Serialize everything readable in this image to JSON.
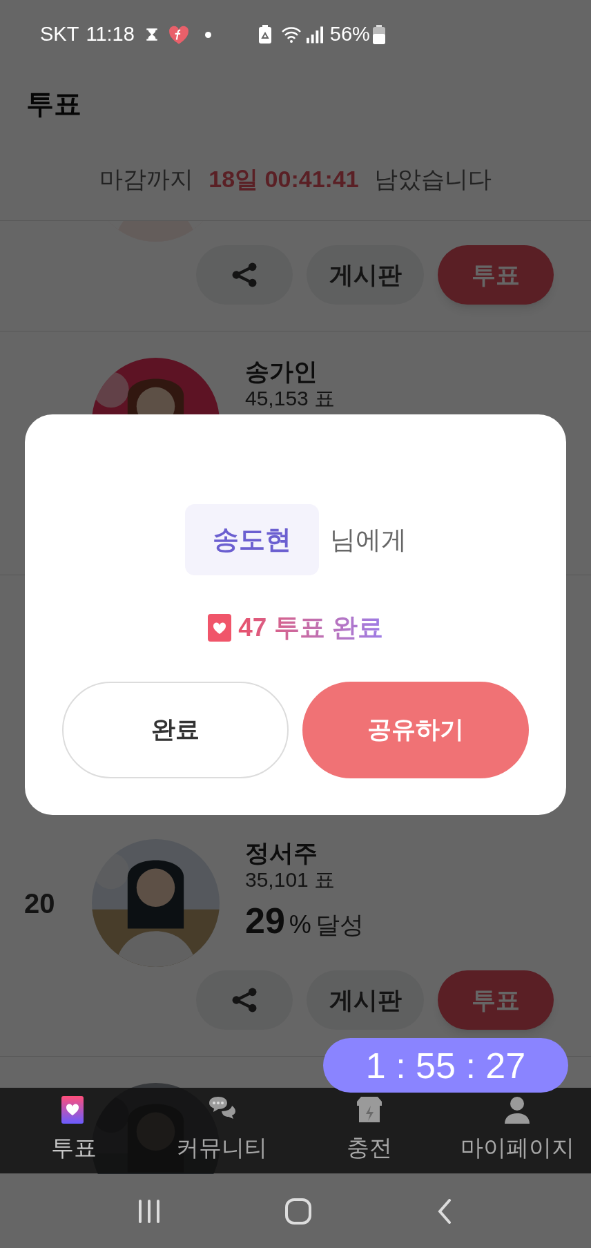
{
  "status_bar": {
    "carrier": "SKT",
    "time": "11:18",
    "battery": "56%"
  },
  "header": {
    "title": "투표"
  },
  "deadline": {
    "prefix": "마감까지",
    "remaining": "18일 00:41:41",
    "suffix": "남았습니다"
  },
  "candidates": [
    {
      "avatar": {
        "kind": "picture"
      },
      "board_button": "게시판",
      "vote_button": "투표"
    },
    {
      "avatar": {
        "kind": "picture"
      },
      "name": "송가인",
      "votes": "45,153 표"
    },
    {
      "avatar": {
        "kind": "picture"
      },
      "rank": "20",
      "name": "정서주",
      "votes": "35,101 표",
      "percent": "29",
      "percent_unit": "%",
      "percent_label": "달성",
      "board_button": "게시판",
      "vote_button": "투표"
    },
    {
      "avatar": {
        "kind": "picture"
      }
    }
  ],
  "bottom_nav": [
    {
      "label": "투표",
      "selected": true
    },
    {
      "label": "커뮤니티",
      "selected": false
    },
    {
      "label": "충전",
      "selected": false
    },
    {
      "label": "마이페이지",
      "selected": false
    }
  ],
  "dialog": {
    "recipient": "송도현",
    "recipient_suffix": "님에게",
    "result": "47 투표 완료",
    "buttons": [
      {
        "label": "완료",
        "kind": "secondary"
      },
      {
        "label": "공유하기",
        "kind": "primary"
      }
    ]
  },
  "timer": "1 : 55 : 27"
}
